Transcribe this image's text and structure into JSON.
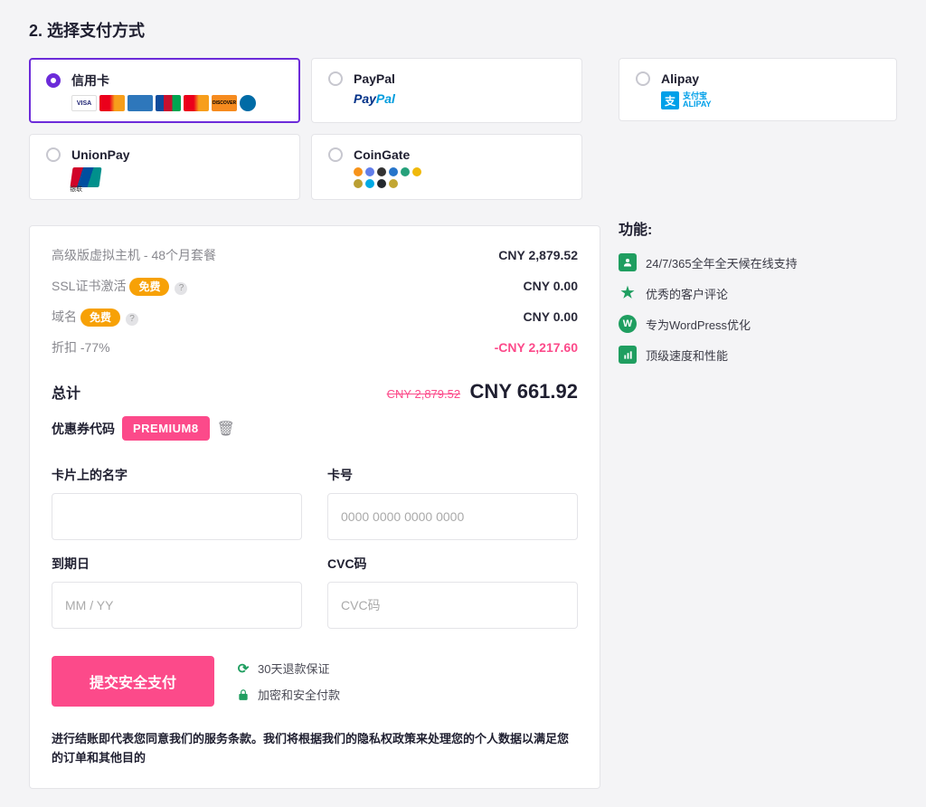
{
  "section_title": "2. 选择支付方式",
  "pay_methods": {
    "credit": "信用卡",
    "paypal": "PayPal",
    "alipay": "Alipay",
    "unionpay": "UnionPay",
    "coingate": "CoinGate",
    "paypal_logo_p1": "Pay",
    "paypal_logo_p2": "Pal",
    "alipay_block": "支",
    "alipay_sub": "支付宝\nALIPAY",
    "visa_txt": "VISA",
    "discover_txt": "DISCOVER"
  },
  "summary": {
    "plan_label": "高级版虚拟主机 - 48个月套餐",
    "plan_price": "CNY 2,879.52",
    "ssl_label": "SSL证书激活",
    "ssl_price": "CNY 0.00",
    "domain_label": "域名",
    "domain_price": "CNY 0.00",
    "discount_label": "折扣 -77%",
    "discount_price": "-CNY 2,217.60",
    "free_badge": "免费",
    "total_label": "总计",
    "old_total": "CNY 2,879.52",
    "new_total": "CNY 661.92",
    "coupon_label": "优惠券代码",
    "coupon_code": "PREMIUM8"
  },
  "form": {
    "name_label": "卡片上的名字",
    "number_label": "卡号",
    "number_ph": "0000 0000 0000 0000",
    "expiry_label": "到期日",
    "expiry_ph": "MM / YY",
    "cvc_label": "CVC码",
    "cvc_ph": "CVC码"
  },
  "submit": {
    "button": "提交安全支付",
    "refund": "30天退款保证",
    "secure": "加密和安全付款"
  },
  "disclaimer": "进行结账即代表您同意我们的服务条款。我们将根据我们的隐私权政策来处理您的个人数据以满足您的订单和其他目的",
  "features": {
    "title": "功能:",
    "f1": "24/7/365全年全天候在线支持",
    "f2": "优秀的客户评论",
    "f3": "专为WordPress优化",
    "f4": "顶级速度和性能"
  }
}
